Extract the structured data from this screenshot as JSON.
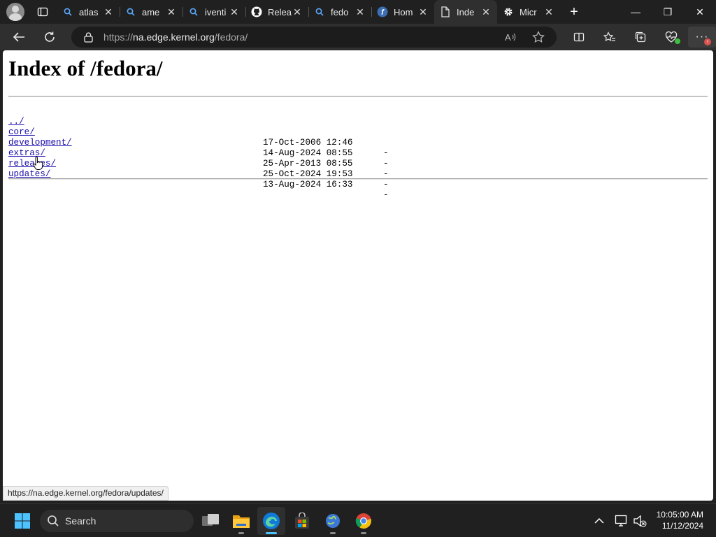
{
  "tabs": [
    {
      "label": "atlas",
      "icon": "search-icon",
      "active": false
    },
    {
      "label": "ame",
      "icon": "search-icon",
      "active": false
    },
    {
      "label": "iventi",
      "icon": "search-icon",
      "active": false
    },
    {
      "label": "Relea",
      "icon": "github-icon",
      "active": false
    },
    {
      "label": "fedo",
      "icon": "search-icon",
      "active": false
    },
    {
      "label": "Hom",
      "icon": "fedora-icon",
      "active": false
    },
    {
      "label": "Inde",
      "icon": "page-icon",
      "active": true
    },
    {
      "label": "Micr",
      "icon": "gear-icon",
      "active": false
    }
  ],
  "address": {
    "prefix": "https://",
    "host": "na.edge.kernel.org",
    "path": "/fedora/"
  },
  "page": {
    "title": "Index of /fedora/",
    "entries": [
      {
        "name": "../",
        "date": "",
        "size": ""
      },
      {
        "name": "core/",
        "date": "17-Oct-2006 12:46",
        "size": "-"
      },
      {
        "name": "development/",
        "date": "14-Aug-2024 08:55",
        "size": "-"
      },
      {
        "name": "extras/",
        "date": "25-Apr-2013 08:55",
        "size": "-"
      },
      {
        "name": "releases/",
        "date": "25-Oct-2024 19:53",
        "size": "-"
      },
      {
        "name": "updates/",
        "date": "13-Aug-2024 16:33",
        "size": "-"
      }
    ]
  },
  "status_url": "https://na.edge.kernel.org/fedora/updates/",
  "taskbar": {
    "search_label": "Search",
    "time": "10:05:00 AM",
    "date": "11/12/2024"
  },
  "colors": {
    "link": "#1a0dab",
    "chrome_dark": "#202020",
    "active_indicator": "#4cc2ff"
  }
}
